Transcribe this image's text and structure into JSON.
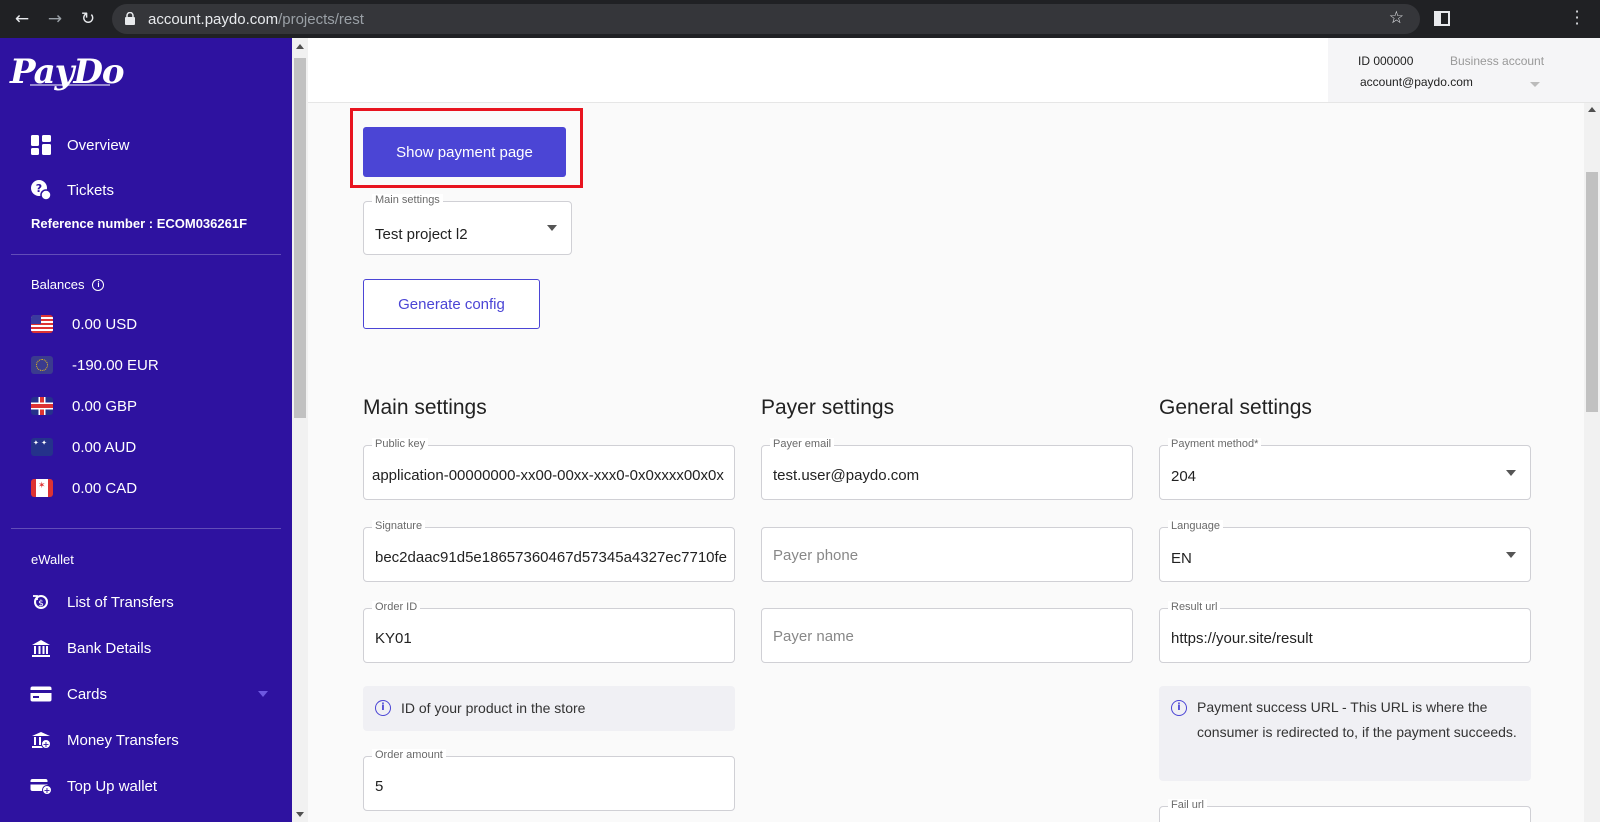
{
  "browser": {
    "url_domain": "account.paydo.com",
    "url_path": "/projects/rest"
  },
  "sidebar": {
    "logo": "PayDo",
    "nav_top": [
      {
        "label": "Overview",
        "icon": "dashboard-icon"
      },
      {
        "label": "Tickets",
        "icon": "tickets-icon"
      }
    ],
    "reference": "Reference number : ECOM036261F",
    "balances_heading": "Balances",
    "balances": [
      {
        "amount": "0.00 USD",
        "icon": "us-flag-icon"
      },
      {
        "amount": "-190.00 EUR",
        "icon": "eu-flag-icon"
      },
      {
        "amount": "0.00 GBP",
        "icon": "uk-flag-icon"
      },
      {
        "amount": "0.00 AUD",
        "icon": "au-flag-icon"
      },
      {
        "amount": "0.00 CAD",
        "icon": "ca-flag-icon"
      }
    ],
    "ewallet_heading": "eWallet",
    "ewallet_items": [
      {
        "label": "List of Transfers",
        "icon": "transfers-icon"
      },
      {
        "label": "Bank Details",
        "icon": "bank-icon"
      },
      {
        "label": "Cards",
        "icon": "card-icon"
      },
      {
        "label": "Money Transfers",
        "icon": "money-transfer-icon"
      },
      {
        "label": "Top Up wallet",
        "icon": "top-up-icon"
      }
    ]
  },
  "account": {
    "id": "ID 000000",
    "type": "Business account",
    "email": "account@paydo.com"
  },
  "actions": {
    "show_payment_page": "Show payment page",
    "generate_config": "Generate config"
  },
  "project_select": {
    "label": "Main settings",
    "value": "Test project l2"
  },
  "main_settings": {
    "title": "Main settings",
    "public_key": {
      "label": "Public key",
      "value": "application-00000000-xx00-00xx-xxx0-0x0xxxx00x0x"
    },
    "signature": {
      "label": "Signature",
      "value": "bec2daac91d5e18657360467d57345a4327ec7710fe"
    },
    "order_id": {
      "label": "Order ID",
      "value": "KY01"
    },
    "order_id_hint": "ID of your product in the store",
    "order_amount": {
      "label": "Order amount",
      "value": "5"
    }
  },
  "payer_settings": {
    "title": "Payer settings",
    "payer_email": {
      "label": "Payer email",
      "value": "test.user@paydo.com"
    },
    "payer_phone": {
      "placeholder": "Payer phone"
    },
    "payer_name": {
      "placeholder": "Payer name"
    }
  },
  "general_settings": {
    "title": "General settings",
    "payment_method": {
      "label": "Payment method*",
      "value": "204"
    },
    "language": {
      "label": "Language",
      "value": "EN"
    },
    "result_url": {
      "label": "Result url",
      "value": "https://your.site/result"
    },
    "result_url_hint": "Payment success URL - This URL is where the consumer is redirected to, if the payment succeeds.",
    "fail_url": {
      "label": "Fail url"
    }
  }
}
